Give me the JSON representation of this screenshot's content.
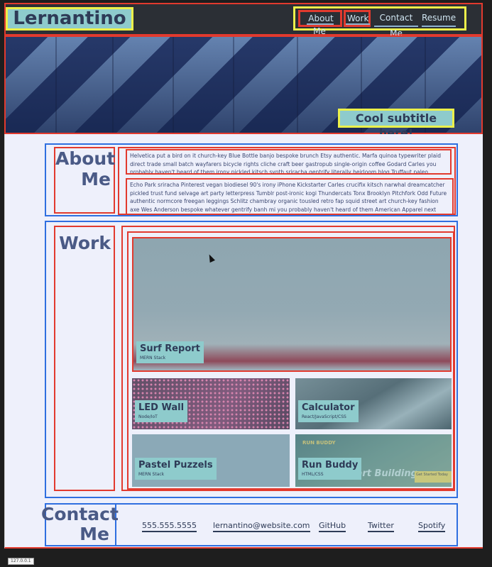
{
  "header": {
    "brand": "Lernantino",
    "nav": [
      "About Me",
      "Work",
      "Contact Me",
      "Resume"
    ]
  },
  "hero": {
    "subtitle": "Cool subtitle here!"
  },
  "about": {
    "heading_line1": "About",
    "heading_line2": "Me",
    "paragraph1": "Helvetica put a bird on it church-key Blue Bottle banjo bespoke brunch Etsy authentic. Marfa quinoa typewriter plaid direct trade small batch wayfarers bicycle rights cliche craft beer gastropub single-origin coffee Godard Carles you probably haven't heard of them irony pickled kitsch synth sriracha gentrify literally heirloom blog Truffaut paleo scenester",
    "paragraph2": "Echo Park sriracha Pinterest vegan biodiesel 90's irony iPhone Kickstarter Carles crucifix kitsch narwhal dreamcatcher pickled trust fund selvage art party letterpress Tumblr post-ironic kogi Thundercats Tonx Brooklyn Pitchfork Odd Future authentic normcore freegan leggings Schlitz chambray organic tousled retro fap squid street art church-key fashion axe Wes Anderson bespoke whatever gentrify banh mi you probably haven't heard of them American Apparel next level pug ugh."
  },
  "work": {
    "heading": "Work",
    "projects": [
      {
        "title": "Surf Report",
        "subtitle": "MERN Stack"
      },
      {
        "title": "LED Wall",
        "subtitle": "Node/IoT"
      },
      {
        "title": "Calculator",
        "subtitle": "React/JavaScript/CSS"
      },
      {
        "title": "Pastel Puzzels",
        "subtitle": "MERN Stack"
      },
      {
        "title": "Run Buddy",
        "subtitle": "HTML/CSS"
      }
    ],
    "run_buddy_brand": "RUN BUDDY",
    "run_buddy_cta": "Start Building",
    "run_buddy_button": "Get Started Today"
  },
  "contact": {
    "heading_line1": "Contact",
    "heading_line2": "Me",
    "links": [
      "555.555.5555",
      "lernantino@website.com",
      "GitHub",
      "Twitter",
      "Spotify"
    ]
  },
  "status_bar": "127.0.0.1",
  "colors": {
    "header_bg": "#2b2f35",
    "label_bg": "#8ecbcc",
    "heading_text": "#4a5a86",
    "page_bg": "#eef0fb",
    "outline_red": "#e23a2e",
    "outline_blue": "#2f6fe0",
    "outline_yellow": "#ecf04a"
  }
}
